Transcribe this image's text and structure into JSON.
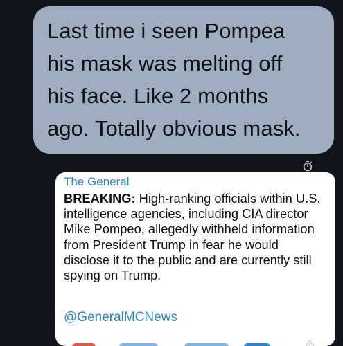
{
  "conversation": {
    "sent_message": {
      "lines": [
        "Last time i seen Pompea",
        "his mask was melting off",
        "his face. Like 2 months",
        "ago. Totally obvious mask."
      ]
    },
    "received_message": {
      "sender": "The General",
      "lead": "BREAKING:",
      "body": " High-ranking officials within U.S. intelligence agencies, including CIA director Mike Pompeo, allegedly withheld information from President Trump in fear he would disclose it to the public and are currently still spying on Trump.",
      "handle": "@GeneralMCNews"
    }
  },
  "icons": {
    "disappearing_timer": "stopwatch-icon"
  },
  "colors": {
    "background": "#11151b",
    "sent_bubble": "#9eaec0",
    "received_bubble": "#ffffff",
    "link": "#2e86c8"
  }
}
